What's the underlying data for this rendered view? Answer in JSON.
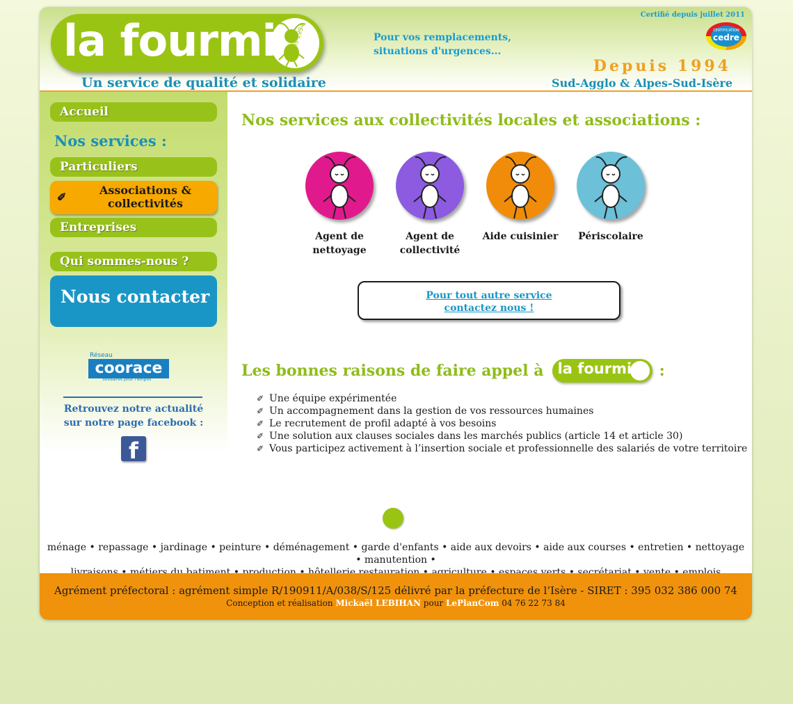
{
  "header": {
    "logo_text": "la fourmi",
    "logo_since": "Depuis 1994",
    "tagline": "Un service de qualité et solidaire",
    "slogan_line1": "Pour vos remplacements,",
    "slogan_line2": "situations d'urgences...",
    "certified": "Certifié depuis juillet 2011",
    "cedre_small": "CERTIFICATION",
    "cedre_big": "cedre",
    "since": "Depuis 1994",
    "region": "Sud-Agglo & Alpes-Sud-Isère"
  },
  "sidebar": {
    "home": "Accueil",
    "services_heading": "Nos services :",
    "particuliers": "Particuliers",
    "associations_line1": "Associations &",
    "associations_line2": "collectivités",
    "entreprises": "Entreprises",
    "about": "Qui sommes-nous ?",
    "contact": "Nous contacter",
    "corace_reseau": "Réseau",
    "corace_brand": "coorace",
    "corace_sub": "Solidaires pour l'emploi",
    "facebook_line1": "Retrouvez notre actualité",
    "facebook_line2": "sur notre page facebook :",
    "facebook_glyph": "f"
  },
  "main": {
    "title": "Nos services aux collectivités locales et associations :",
    "services": [
      {
        "line1": "Agent de",
        "line2": "nettoyage",
        "color": "#e01a8c"
      },
      {
        "line1": "Agent de",
        "line2": "collectivité",
        "color": "#8c5be0"
      },
      {
        "line1": "Aide cuisinier",
        "line2": "",
        "color": "#f08c0a"
      },
      {
        "line1": "Périscolaire",
        "line2": "",
        "color": "#6cc0d8"
      }
    ],
    "other_line1": "Pour tout autre service",
    "other_line2": "contactez nous !",
    "reasons_title": "Les bonnes raisons de faire appel à",
    "reasons_logo": "la fourmi",
    "reasons_colon": ":",
    "reasons": [
      "Une équipe expérimentée",
      "Un accompagnement dans la gestion de vos ressources humaines",
      "Le recrutement de profil adapté à vos besoins",
      "Une solution aux clauses sociales dans les marchés publics (article 14 et article 30)",
      "Vous participez activement à l’insertion sociale et professionnelle des salariés de votre territoire"
    ]
  },
  "keywords": {
    "line1": "ménage • repassage • jardinage • peinture • déménagement • garde d'enfants • aide aux devoirs • aide aux courses • entretien • nettoyage • manutention •",
    "line2": "livraisons • métiers du batiment • production • hôtellerie restauration • agriculture • espaces verts • secrétariat • vente • emplois saisonniers"
  },
  "footer": {
    "agrement": "Agrément préfectoral : agrément simple R/190911/A/038/S/125 délivré par la préfecture de l’Isère - SIRET : 395 032 386 000 74",
    "credits_prefix": "Conception et réalisation",
    "author": "Mickaël LEBIHAN",
    "credits_mid": "pour",
    "agency": "LePlanCom",
    "phone": "04 76 22 73 84"
  },
  "colors": {
    "brand_green": "#9ac414",
    "accent_orange": "#f0920c",
    "accent_blue": "#1a96c6"
  }
}
